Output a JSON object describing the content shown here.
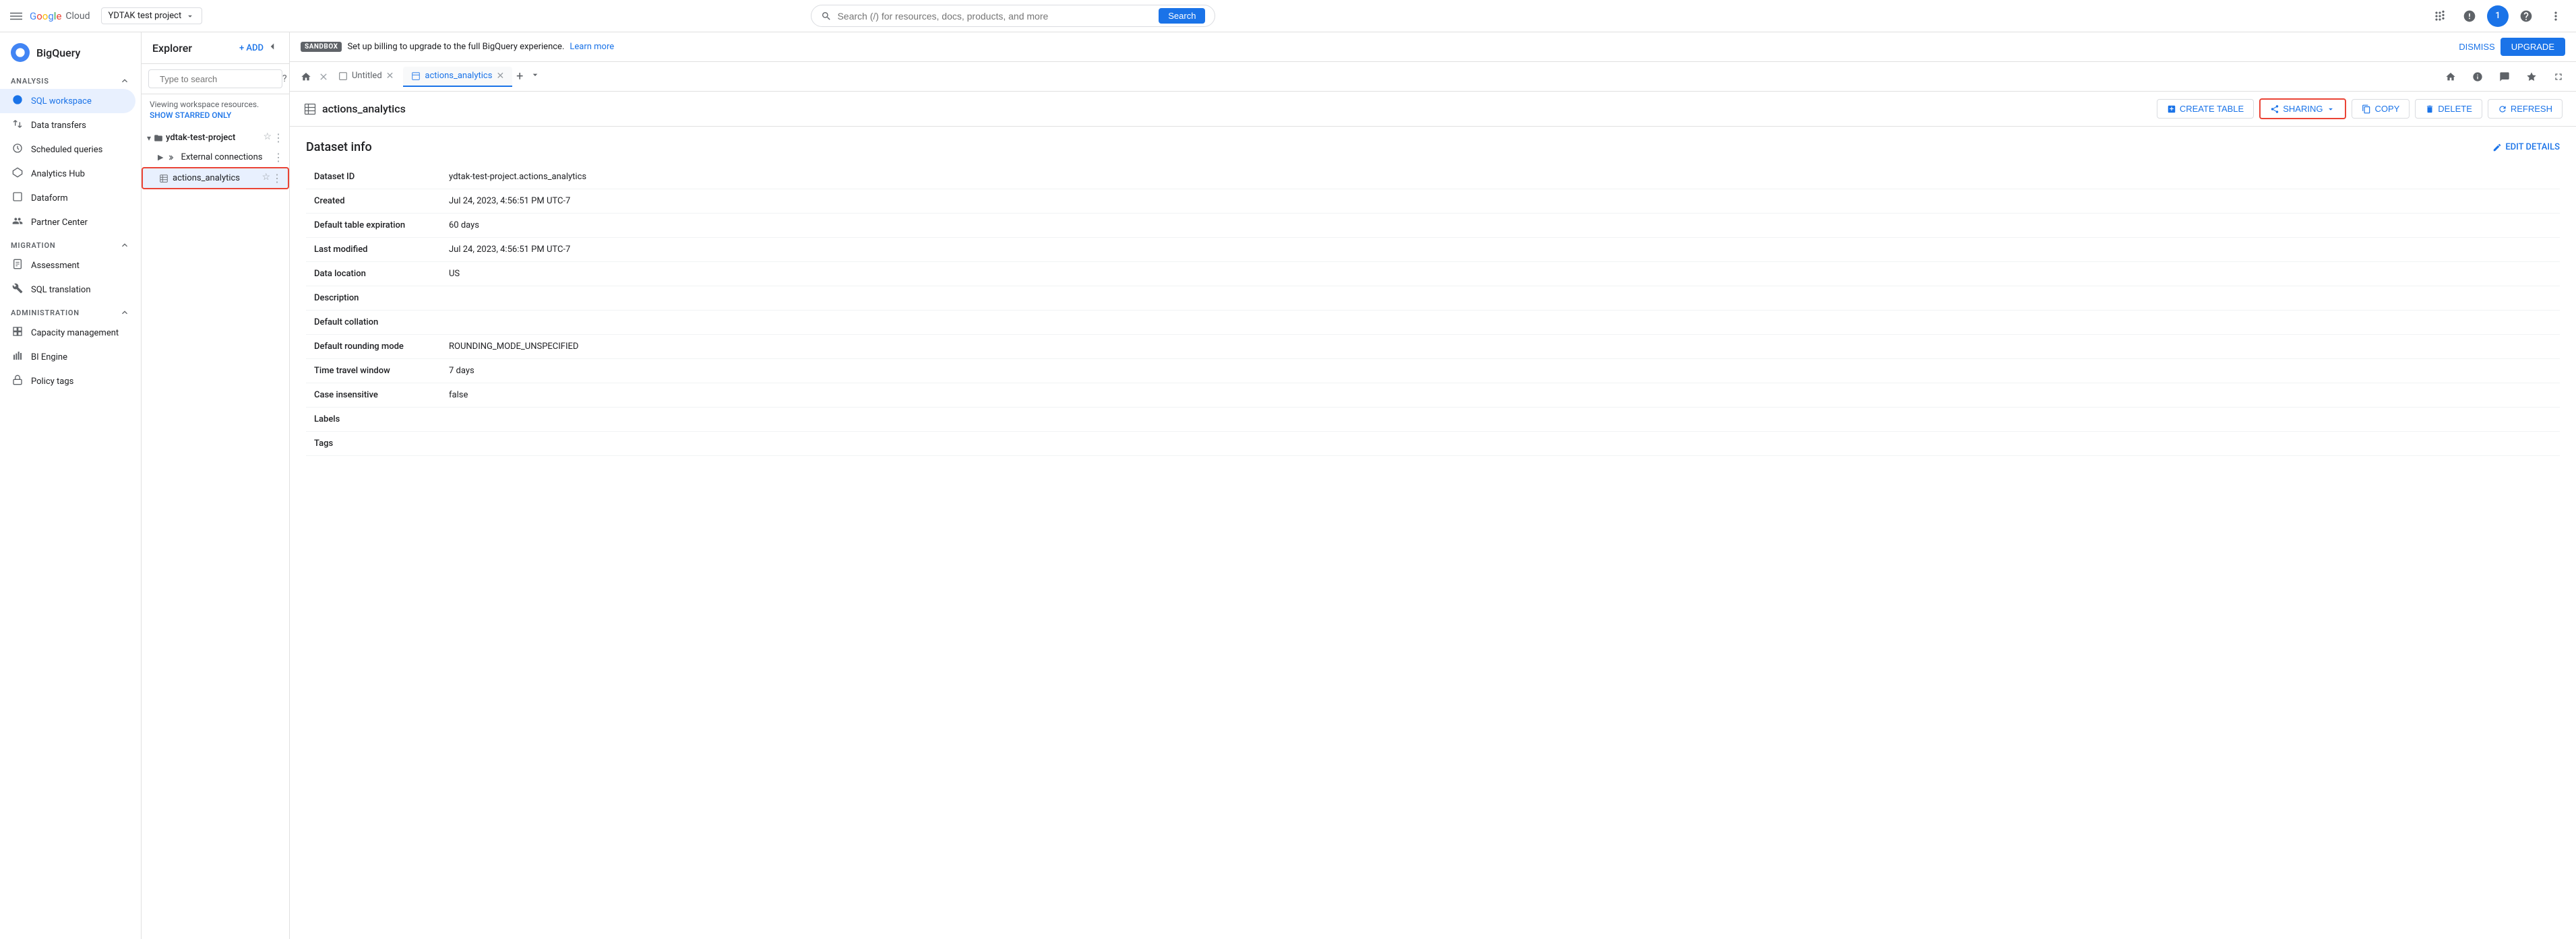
{
  "topbar": {
    "menu_icon": "☰",
    "logo_g": "G",
    "logo_text": "oogle Cloud",
    "project_name": "YDTAK test project",
    "search_placeholder": "Search (/) for resources, docs, products, and more",
    "search_button": "Search",
    "apps_icon": "⠿",
    "notifications_icon": "🔔",
    "help_icon": "?",
    "more_icon": "⋮",
    "avatar_label": "1"
  },
  "sandbox_banner": {
    "badge": "SANDBOX",
    "message": "Set up billing to upgrade to the full BigQuery experience.",
    "link_text": "Learn more",
    "dismiss_label": "DISMISS",
    "upgrade_label": "UPGRADE"
  },
  "sidebar": {
    "app_name": "BigQuery",
    "sections": [
      {
        "label": "Analysis",
        "items": [
          {
            "id": "sql-workspace",
            "label": "SQL workspace",
            "icon": "◉",
            "active": true
          },
          {
            "id": "data-transfers",
            "label": "Data transfers",
            "icon": "⇄"
          },
          {
            "id": "scheduled-queries",
            "label": "Scheduled queries",
            "icon": "⏱"
          },
          {
            "id": "analytics-hub",
            "label": "Analytics Hub",
            "icon": "⬡"
          },
          {
            "id": "dataform",
            "label": "Dataform",
            "icon": "◇"
          },
          {
            "id": "partner-center",
            "label": "Partner Center",
            "icon": "🤝"
          }
        ]
      },
      {
        "label": "Migration",
        "items": [
          {
            "id": "assessment",
            "label": "Assessment",
            "icon": "📋"
          },
          {
            "id": "sql-translation",
            "label": "SQL translation",
            "icon": "🔧"
          }
        ]
      },
      {
        "label": "Administration",
        "items": [
          {
            "id": "capacity-management",
            "label": "Capacity management",
            "icon": "⊞"
          },
          {
            "id": "bi-engine",
            "label": "BI Engine",
            "icon": "📊"
          },
          {
            "id": "policy-tags",
            "label": "Policy tags",
            "icon": "🔒"
          }
        ]
      }
    ]
  },
  "explorer": {
    "title": "Explorer",
    "add_label": "+ ADD",
    "collapse_icon": "◁",
    "search_placeholder": "Type to search",
    "search_help_icon": "?",
    "workspace_text": "Viewing workspace resources.",
    "show_starred_label": "SHOW STARRED ONLY",
    "project": {
      "name": "ydtak-test-project",
      "expand_icon": "▾",
      "items": [
        {
          "id": "external-connections",
          "label": "External connections",
          "icon": "⇌",
          "selected": false,
          "expand_icon": "▶"
        },
        {
          "id": "actions-analytics",
          "label": "actions_analytics",
          "icon": "▦",
          "selected": true
        }
      ]
    }
  },
  "tabs": {
    "home_icon": "⌂",
    "items": [
      {
        "id": "untitled",
        "label": "Untitled",
        "closable": true,
        "active": false
      },
      {
        "id": "actions-analytics",
        "label": "actions_analytics",
        "closable": true,
        "active": true
      }
    ],
    "add_icon": "+",
    "more_icon": "⌄"
  },
  "toolbar": {
    "dataset_icon": "▦",
    "dataset_name": "actions_analytics",
    "create_table_label": "CREATE TABLE",
    "sharing_label": "SHARING",
    "copy_label": "COPY",
    "delete_label": "DELETE",
    "refresh_label": "REFRESH"
  },
  "dataset": {
    "section_title": "Dataset info",
    "edit_details_label": "EDIT DETAILS",
    "fields": [
      {
        "key": "Dataset ID",
        "value": "ydtak-test-project.actions_analytics"
      },
      {
        "key": "Created",
        "value": "Jul 24, 2023, 4:56:51 PM UTC-7"
      },
      {
        "key": "Default table expiration",
        "value": "60 days"
      },
      {
        "key": "Last modified",
        "value": "Jul 24, 2023, 4:56:51 PM UTC-7"
      },
      {
        "key": "Data location",
        "value": "US"
      },
      {
        "key": "Description",
        "value": ""
      },
      {
        "key": "Default collation",
        "value": ""
      },
      {
        "key": "Default rounding mode",
        "value": "ROUNDING_MODE_UNSPECIFIED"
      },
      {
        "key": "Time travel window",
        "value": "7 days"
      },
      {
        "key": "Case insensitive",
        "value": "false"
      },
      {
        "key": "Labels",
        "value": ""
      },
      {
        "key": "Tags",
        "value": ""
      }
    ]
  }
}
